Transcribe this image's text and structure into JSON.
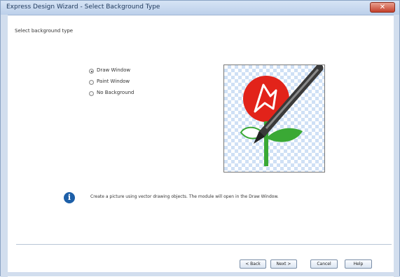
{
  "window": {
    "title": "Express Design Wizard - Select Background Type",
    "close_glyph": "✕"
  },
  "page": {
    "heading": "Select background type"
  },
  "options": [
    {
      "label": "Draw Window",
      "selected": true
    },
    {
      "label": "Paint Window",
      "selected": false
    },
    {
      "label": "No Background",
      "selected": false
    }
  ],
  "info": {
    "icon_glyph": "i",
    "text": "Create a picture using vector drawing objects. The module will open in the Draw Window."
  },
  "buttons": {
    "back": "< Back",
    "next": "Next >",
    "cancel": "Cancel",
    "help": "Help"
  },
  "colors": {
    "rose": "#e2231a",
    "stem": "#3aa935",
    "info_icon": "#1d5fa8"
  }
}
